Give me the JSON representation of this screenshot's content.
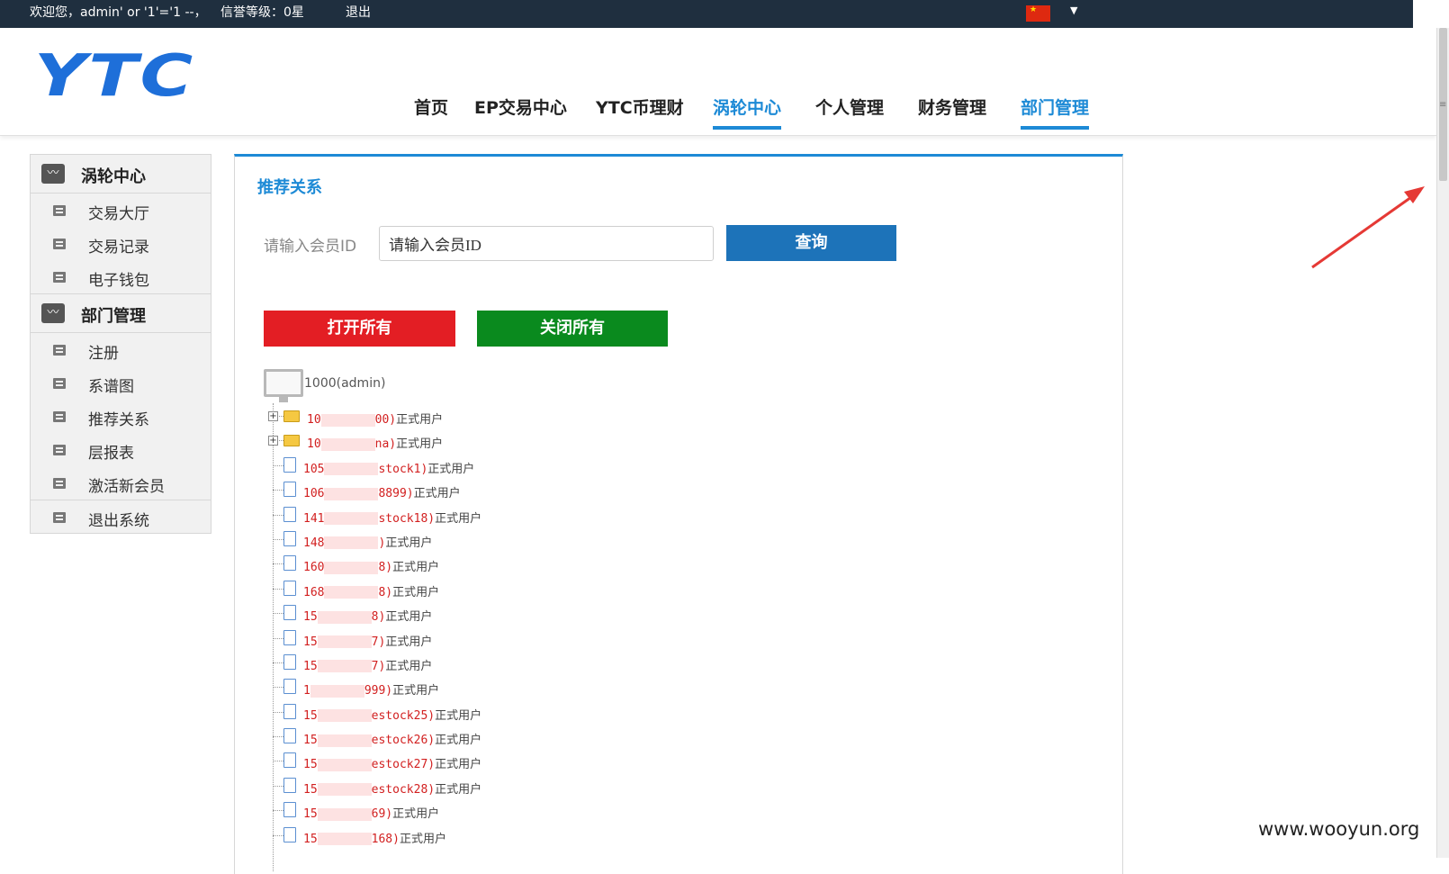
{
  "topbar": {
    "welcome": "欢迎您，admin' or '1'='1 --，",
    "credit": "信誉等级：0星",
    "logout": "退出",
    "flag_icon": "china-flag-icon",
    "caret_icon": "caret-down-icon"
  },
  "header": {
    "logo": "YTC",
    "nav": [
      {
        "label": "首页",
        "active": false
      },
      {
        "label": "EP交易中心",
        "active": false
      },
      {
        "label": "YTC币理财",
        "active": false
      },
      {
        "label": "涡轮中心",
        "active": true
      },
      {
        "label": "个人管理",
        "active": false
      },
      {
        "label": "财务管理",
        "active": false
      },
      {
        "label": "部门管理",
        "active": true
      }
    ]
  },
  "sidebar": {
    "section1": {
      "title": "涡轮中心",
      "items": [
        "交易大厅",
        "交易记录",
        "电子钱包"
      ]
    },
    "section2": {
      "title": "部门管理",
      "items": [
        "注册",
        "系谱图",
        "推荐关系",
        "层报表",
        "激活新会员"
      ]
    },
    "logout": "退出系统"
  },
  "main": {
    "title": "推荐关系",
    "member_id_label": "请输入会员ID",
    "member_id_value": "请输入会员ID",
    "query_button": "查询",
    "open_all_button": "打开所有",
    "close_all_button": "关闭所有",
    "tree_root": "1000(admin)",
    "tree_nodes": [
      {
        "type": "folder",
        "prefix": "10",
        "suffix": "00)",
        "status": "正式用户"
      },
      {
        "type": "folder",
        "prefix": "10",
        "suffix": "na)",
        "status": "正式用户"
      },
      {
        "type": "file",
        "prefix": "105",
        "suffix": "stock1)",
        "status": "正式用户"
      },
      {
        "type": "file",
        "prefix": "106",
        "suffix": "8899)",
        "status": "正式用户"
      },
      {
        "type": "file",
        "prefix": "141",
        "suffix": "stock18)",
        "status": "正式用户"
      },
      {
        "type": "file",
        "prefix": "148",
        "suffix": ")",
        "status": "正式用户"
      },
      {
        "type": "file",
        "prefix": "160",
        "suffix": "8)",
        "status": "正式用户"
      },
      {
        "type": "file",
        "prefix": "168",
        "suffix": "8)",
        "status": "正式用户"
      },
      {
        "type": "file",
        "prefix": "15",
        "suffix": "8)",
        "status": "正式用户"
      },
      {
        "type": "file",
        "prefix": "15",
        "suffix": "7)",
        "status": "正式用户"
      },
      {
        "type": "file",
        "prefix": "15",
        "suffix": "7)",
        "status": "正式用户"
      },
      {
        "type": "file",
        "prefix": "1",
        "suffix": "999)",
        "status": "正式用户"
      },
      {
        "type": "file",
        "prefix": "15",
        "suffix": "estock25)",
        "status": "正式用户"
      },
      {
        "type": "file",
        "prefix": "15",
        "suffix": "estock26)",
        "status": "正式用户"
      },
      {
        "type": "file",
        "prefix": "15",
        "suffix": "estock27)",
        "status": "正式用户"
      },
      {
        "type": "file",
        "prefix": "15",
        "suffix": "estock28)",
        "status": "正式用户"
      },
      {
        "type": "file",
        "prefix": "15",
        "suffix": "69)",
        "status": "正式用户"
      },
      {
        "type": "file",
        "prefix": "15",
        "suffix": "168)",
        "status": "正式用户"
      }
    ]
  },
  "watermark": "www.wooyun.org",
  "colors": {
    "accent": "#1d8ad6",
    "query": "#1d73b9",
    "open": "#e31e24",
    "close": "#0a8a1e",
    "arrow": "#e53935"
  }
}
